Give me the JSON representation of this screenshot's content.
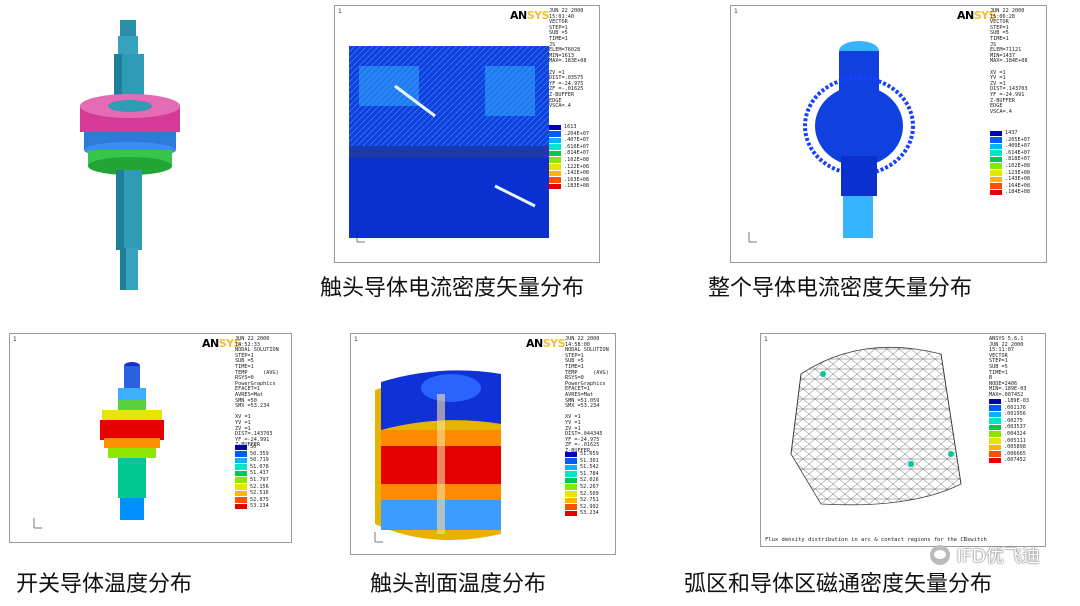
{
  "panels": [
    {
      "id": "p1",
      "caption": "",
      "has_frame": false
    },
    {
      "id": "p2",
      "caption": "触头导体电流密度矢量分布",
      "corner_number": "1",
      "info_text": "JUN 22 2000\n15:01:40\nVECTOR\nSTEP=1\nSUB =5\nTIME=1\nJS\nELEM=76028\nMIN=1613\nMAX=.183E+08\n\nZV =1\nDIST=.03575\nYF =-24.975\nZF =-.01625\nZ-BUFFER\nEDGE\nVSCA=.4",
      "legend": [
        "1613",
        ".204E+07",
        ".407E+07",
        ".610E+07",
        ".814E+07",
        ".102E+08",
        ".122E+08",
        ".142E+08",
        ".163E+08",
        ".183E+08"
      ]
    },
    {
      "id": "p3",
      "caption": "整个导体电流密度矢量分布",
      "corner_number": "1",
      "info_text": "JUN 22 2000\n15:06:28\nVECTOR\nSTEP=1\nSUB =5\nTIME=1\nJS\nELEM=71121\nMIN=1437\nMAX=.184E+08\n\nXV =1\nYV =1\nZV =1\nDIST=.143703\nYF =-24.991\nZ-BUFFER\nEDGE\nVSCA=.4",
      "legend": [
        "1437",
        ".205E+07",
        ".409E+07",
        ".614E+07",
        ".818E+07",
        ".102E+08",
        ".123E+08",
        ".143E+08",
        ".164E+08",
        ".184E+08"
      ]
    },
    {
      "id": "p4",
      "caption": "开关导体温度分布",
      "corner_number": "1",
      "info_text": "JUN 22 2000\n14:52:33\nNODAL SOLUTION\nSTEP=1\nSUB =5\nTIME=1\nTEMP     (AVG)\nRSYS=0\nPowerGraphics\nEFACET=1\nAVRES=Mat\nSMN =50\nSMX =53.234\n\nXV =1\nYV =1\nZV =1\nDIST=.143703\nYF =-24.991\nZ-BUFFER",
      "legend": [
        "50",
        "50.359",
        "50.719",
        "51.078",
        "51.437",
        "51.797",
        "52.156",
        "52.516",
        "52.875",
        "53.234"
      ]
    },
    {
      "id": "p5",
      "caption": "触头剖面温度分布",
      "corner_number": "1",
      "info_text": "JUN 22 2000\n14:58:00\nNODAL SOLUTION\nSTEP=1\nSUB =5\nTIME=1\nTEMP     (AVG)\nRSYS=0\nPowerGraphics\nEFACET=1\nAVRES=Mat\nSMN =51.059\nSMX =53.234\n\nXV =1\nYV =1\nZV =1\nDIST=.044345\nYF =-24.975\nZF =-.01625\nZ-BUFFER",
      "legend": [
        "51.059",
        "51.301",
        "51.542",
        "51.784",
        "52.026",
        "52.267",
        "52.509",
        "52.751",
        "52.992",
        "53.234"
      ]
    },
    {
      "id": "p6",
      "caption": "弧区和导体区磁通密度矢量分布",
      "corner_number": "1",
      "info_text": "ANSYS 5.6.1\nJUN 22 2000\n15:11:07\nVECTOR\nSTEP=1\nSUB =5\nTIME=1\nB\nNODE=2406\nMIN=.189E-03\nMAX=.007452\n",
      "legend": [
        ".189E-03",
        ".001176",
        ".001956",
        ".00275",
        ".003537",
        ".004324",
        ".005111",
        ".005898",
        ".006665",
        ".007452"
      ],
      "bottom_note": "Flux density distribution in arc & contact regions for the CBswitch"
    }
  ],
  "brand": {
    "an": "AN",
    "sys": "SYS"
  },
  "legend_colors": [
    "#0000b4",
    "#005cff",
    "#00b4ff",
    "#00e6c8",
    "#00c850",
    "#8ce600",
    "#e6e600",
    "#ffb400",
    "#ff5000",
    "#e60000"
  ],
  "watermark": {
    "text": "IFD优飞迪"
  }
}
